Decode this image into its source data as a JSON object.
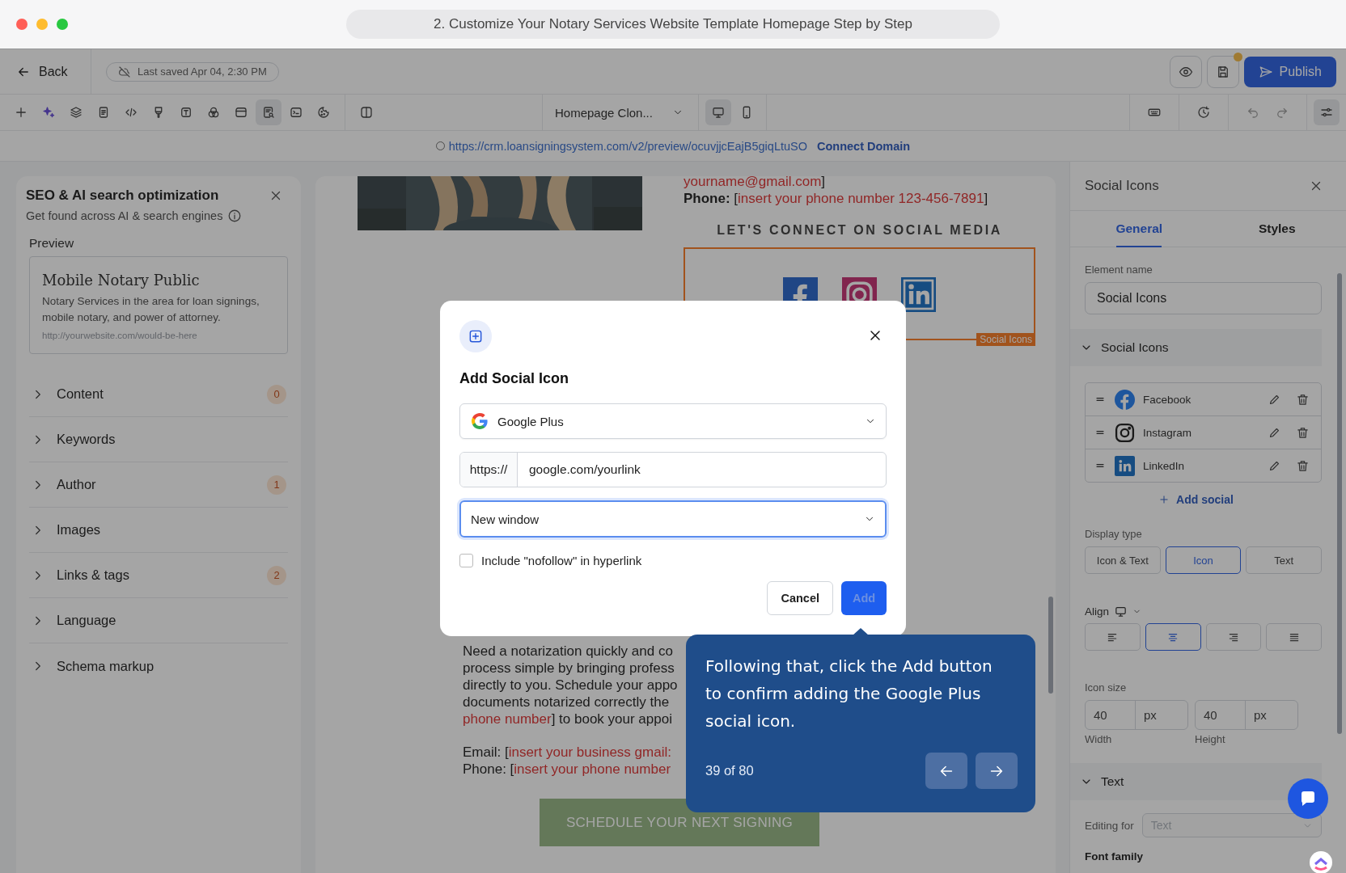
{
  "browser": {
    "title": "2. Customize Your Notary Services Website Template Homepage Step by Step"
  },
  "topbar": {
    "back": "Back",
    "saved": "Last saved Apr 04, 2:30 PM",
    "unsaved_changes": true,
    "publish": "Publish"
  },
  "toolbar": {
    "tools": [
      {
        "kind": "plus",
        "selected": false
      },
      {
        "kind": "sparkle",
        "selected": false
      },
      {
        "kind": "layers",
        "selected": false
      },
      {
        "kind": "page",
        "selected": false
      },
      {
        "kind": "code",
        "selected": false
      },
      {
        "kind": "brush",
        "selected": false
      },
      {
        "kind": "text",
        "selected": false
      },
      {
        "kind": "shapes",
        "selected": false
      },
      {
        "kind": "panel",
        "selected": false
      },
      {
        "kind": "seo",
        "selected": true
      },
      {
        "kind": "terminal",
        "selected": false
      },
      {
        "kind": "cookie",
        "selected": false
      }
    ],
    "page_select": "Homepage Clon...",
    "devices": [
      {
        "kind": "desktop",
        "selected": true
      },
      {
        "kind": "mobile",
        "selected": false
      }
    ]
  },
  "url_bar": {
    "url": "https://crm.loansigningsystem.com/v2/preview/ocuvjjcEajB5giqLtuSO",
    "connect": "Connect Domain"
  },
  "seo_panel": {
    "title": "SEO & AI search optimization",
    "subtitle": "Get found across AI & search engines",
    "preview_label": "Preview",
    "preview": {
      "title": "Mobile Notary Public",
      "description": "Notary Services in the area for loan signings, mobile notary, and power of attorney.",
      "url": "http://yourwebsite.com/would-be-here"
    },
    "sections": [
      {
        "label": "Content",
        "badge": "0",
        "expanded": false
      },
      {
        "label": "Keywords",
        "expanded": false
      },
      {
        "label": "Author",
        "badge": "1",
        "expanded": false
      },
      {
        "label": "Images",
        "expanded": false
      },
      {
        "label": "Links & tags",
        "badge": "2",
        "expanded": false
      },
      {
        "label": "Language",
        "expanded": false
      },
      {
        "label": "Schema markup",
        "expanded": false
      }
    ]
  },
  "canvas": {
    "contact_lines": [
      [
        {
          "kind": "placeholder",
          "text": "yourname@gmail.com"
        },
        {
          "kind": "plain",
          "text": "]"
        }
      ],
      [
        {
          "kind": "label",
          "text": "Phone: "
        },
        {
          "kind": "plain",
          "text": "["
        },
        {
          "kind": "placeholder",
          "text": "insert your phone number 123-456-7891"
        },
        {
          "kind": "plain",
          "text": "]"
        }
      ]
    ],
    "social_heading": "LET'S CONNECT ON SOCIAL MEDIA",
    "social_block": {
      "label": "Social Icons",
      "icons": [
        {
          "kind": "facebook"
        },
        {
          "kind": "instagram"
        },
        {
          "kind": "linkedin"
        }
      ]
    },
    "paragraphs": [
      [
        [
          {
            "kind": "plain",
            "text": "Need a notarization quickly and co"
          }
        ],
        [
          {
            "kind": "plain",
            "text": "process simple by bringing profess"
          }
        ],
        [
          {
            "kind": "plain",
            "text": "directly to you. Schedule your appo"
          }
        ],
        [
          {
            "kind": "plain",
            "text": "documents notarized correctly the"
          }
        ],
        [
          {
            "kind": "placeholder",
            "text": "phone number"
          },
          {
            "kind": "plain",
            "text": "] to book your appoi"
          }
        ]
      ],
      [
        [
          {
            "kind": "plain",
            "text": "Email: ["
          },
          {
            "kind": "placeholder",
            "text": "insert your business gmail:"
          }
        ],
        [
          {
            "kind": "plain",
            "text": "Phone: ["
          },
          {
            "kind": "placeholder",
            "text": "insert your phone number"
          }
        ]
      ]
    ],
    "cta": "SCHEDULE YOUR NEXT SIGNING"
  },
  "modal": {
    "title": "Add Social Icon",
    "network": "Google Plus",
    "prefix": "https://",
    "link": "google.com/yourlink",
    "target": "New window",
    "nofollow": {
      "label": "Include \"nofollow\" in hyperlink",
      "checked": false
    },
    "cancel": "Cancel",
    "add": "Add"
  },
  "tour_tip": {
    "text": "Following that, click the Add button to confirm adding the Google Plus social icon.",
    "counter": "39 of 80"
  },
  "settings_panel": {
    "title": "Social Icons",
    "tabs": [
      {
        "label": "General",
        "selected": true
      },
      {
        "label": "Styles",
        "selected": false
      }
    ],
    "element_name_label": "Element name",
    "element_name": "Social Icons",
    "social_section": {
      "title": "Social Icons",
      "expanded": true,
      "items": [
        {
          "kind": "facebook",
          "name": "Facebook"
        },
        {
          "kind": "instagram",
          "name": "Instagram"
        },
        {
          "kind": "linkedin",
          "name": "LinkedIn"
        }
      ],
      "add": "Add social"
    },
    "display_type": {
      "label": "Display type",
      "options": [
        {
          "label": "Icon & Text",
          "selected": false
        },
        {
          "label": "Icon",
          "selected": true
        },
        {
          "label": "Text",
          "selected": false
        }
      ]
    },
    "align": {
      "label": "Align",
      "options": [
        {
          "kind": "left",
          "selected": false
        },
        {
          "kind": "center",
          "selected": true
        },
        {
          "kind": "right",
          "selected": false
        },
        {
          "kind": "justify",
          "selected": false
        }
      ]
    },
    "icon_size": {
      "label": "Icon size",
      "fields": [
        {
          "value": "40",
          "unit": "px",
          "caption": "Width"
        },
        {
          "value": "40",
          "unit": "px",
          "caption": "Height"
        }
      ]
    },
    "text_section": {
      "title": "Text",
      "expanded": true
    },
    "editing_for": {
      "label": "Editing for",
      "value": "Text",
      "disabled": true
    },
    "font_family_label": "Font family"
  }
}
